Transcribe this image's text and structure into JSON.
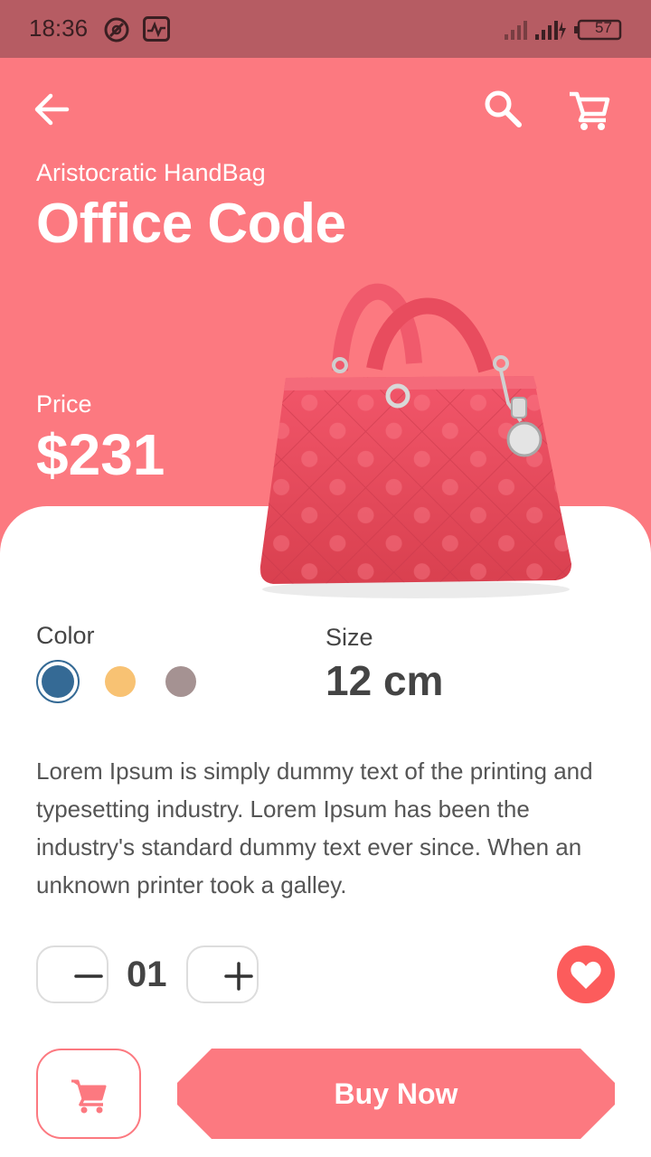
{
  "status_bar": {
    "time": "18:36",
    "battery": "57",
    "icons": [
      "camera-dnd-icon",
      "activity-icon",
      "signal-icon",
      "battery-icon"
    ]
  },
  "header": {
    "icons": [
      "arrow-back-icon",
      "search-icon",
      "cart-icon"
    ]
  },
  "product": {
    "subtitle": "Aristocratic HandBag",
    "title": "Office Code",
    "price_label": "Price",
    "price": "$231"
  },
  "options": {
    "color_label": "Color",
    "colors": [
      "#356a95",
      "#f8c273",
      "#a59292"
    ],
    "selected_color_index": 0,
    "size_label": "Size",
    "size_value": "12 cm"
  },
  "description": "Lorem Ipsum is simply dummy text of the printing and typesetting industry. Lorem Ipsum has been the industry's standard dummy text ever since. When an unknown printer took a galley.",
  "quantity": {
    "value": "01"
  },
  "actions": {
    "buy_label": "Buy Now"
  },
  "theme": {
    "accent": "#fc7980",
    "status_bar": "#b65c63",
    "favorite": "#fc5c5c"
  }
}
